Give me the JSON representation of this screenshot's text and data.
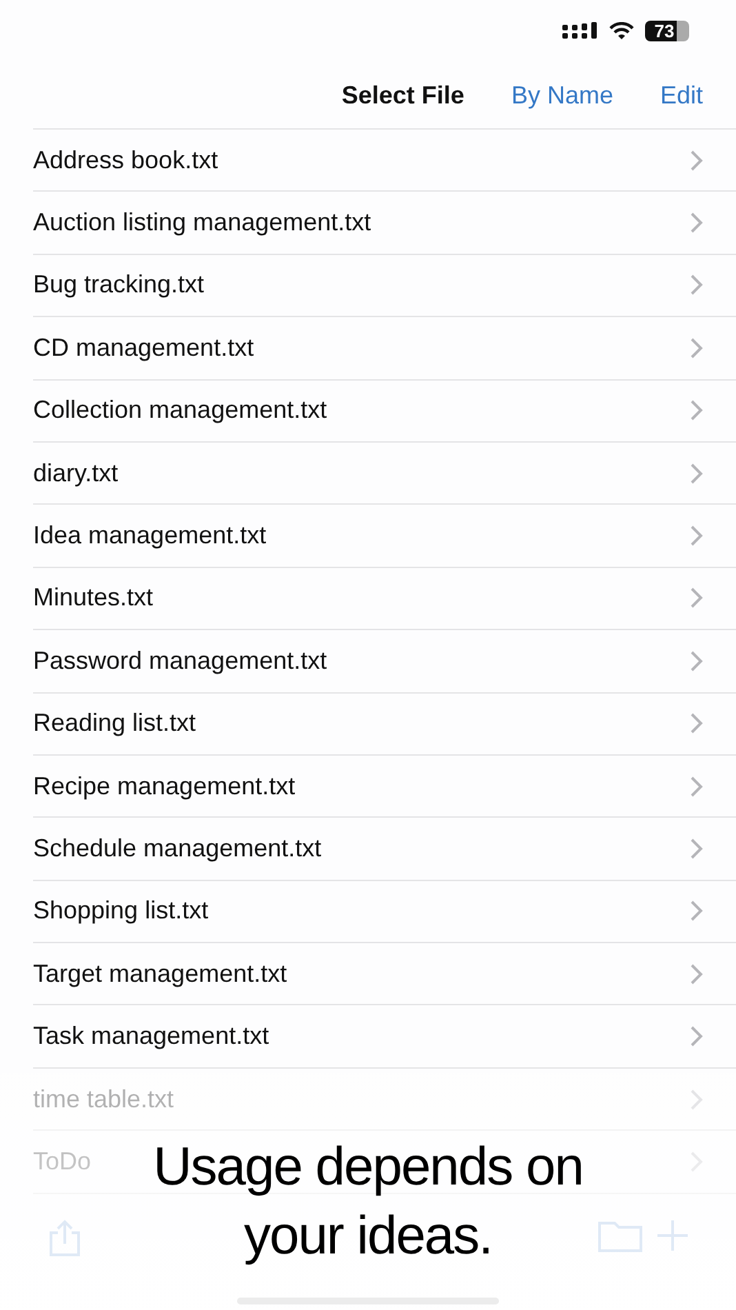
{
  "status_bar": {
    "battery": "73"
  },
  "nav": {
    "title": "Select File",
    "sort_button": "By Name",
    "edit_button": "Edit"
  },
  "files": [
    {
      "name": "Address book.txt",
      "faded": false
    },
    {
      "name": "Auction listing management.txt",
      "faded": false
    },
    {
      "name": "Bug tracking.txt",
      "faded": false
    },
    {
      "name": "CD management.txt",
      "faded": false
    },
    {
      "name": "Collection management.txt",
      "faded": false
    },
    {
      "name": "diary.txt",
      "faded": false
    },
    {
      "name": "Idea management.txt",
      "faded": false
    },
    {
      "name": "Minutes.txt",
      "faded": false
    },
    {
      "name": "Password management.txt",
      "faded": false
    },
    {
      "name": "Reading list.txt",
      "faded": false
    },
    {
      "name": "Recipe management.txt",
      "faded": false
    },
    {
      "name": "Schedule management.txt",
      "faded": false
    },
    {
      "name": "Shopping list.txt",
      "faded": false
    },
    {
      "name": "Target management.txt",
      "faded": false
    },
    {
      "name": "Task management.txt",
      "faded": false
    },
    {
      "name": "time table.txt",
      "faded": true
    },
    {
      "name": "ToDo",
      "faded": true
    }
  ],
  "caption": "Usage depends on your ideas."
}
